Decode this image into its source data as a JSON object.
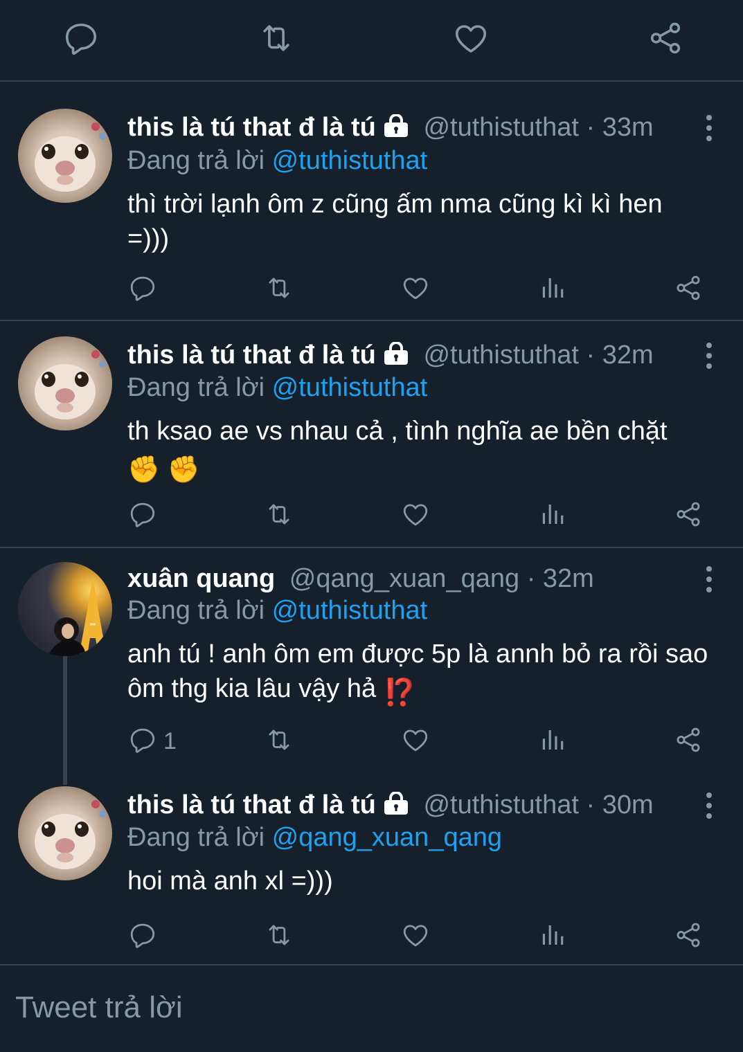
{
  "colors": {
    "background": "#15202b",
    "text": "#ffffff",
    "muted": "#8899a6",
    "link": "#1da1f2",
    "divider": "#38444d"
  },
  "top_actions": [
    "reply-icon",
    "retweet-icon",
    "like-icon",
    "share-icon"
  ],
  "tweets": [
    {
      "name": "this là tú that đ là tú",
      "handle": "@tuthistuthat",
      "sep": "·",
      "time": "33m",
      "replying_prefix": "Đang trả lời",
      "replying_to": "@tuthistuthat",
      "text": "thì trời lạnh ôm z cũng ấm nma cũng kì kì hen =)))",
      "reply_count": ""
    },
    {
      "name": "this là tú that đ là tú",
      "handle": "@tuthistuthat",
      "sep": "·",
      "time": "32m",
      "replying_prefix": "Đang trả lời",
      "replying_to": "@tuthistuthat",
      "text": "th ksao ae vs nhau cả , tình nghĩa ae bền chặt",
      "emoji": "✊ ✊",
      "reply_count": ""
    },
    {
      "name": "xuân quang",
      "handle": "@qang_xuan_qang",
      "sep": "·",
      "time": "32m",
      "replying_prefix": "Đang trả lời",
      "replying_to": "@tuthistuthat",
      "text": "anh tú ! anh ôm em được 5p là annh bỏ ra rồi sao ôm thg kia lâu vậy hả",
      "emoji": "⁉️",
      "reply_count": "1"
    },
    {
      "name": "this là tú that đ là tú",
      "handle": "@tuthistuthat",
      "sep": "·",
      "time": "30m",
      "replying_prefix": "Đang trả lời",
      "replying_to": "@qang_xuan_qang",
      "text": "hoi mà anh xl =)))",
      "reply_count": ""
    }
  ],
  "composer": {
    "placeholder": "Tweet trả lời"
  }
}
